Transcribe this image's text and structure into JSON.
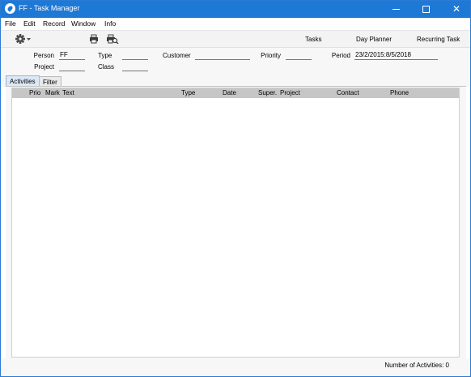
{
  "window": {
    "title": "FF - Task Manager"
  },
  "menu": [
    "File",
    "Edit",
    "Record",
    "Window",
    "Info"
  ],
  "toolbar": {
    "icons": [
      "gear-icon",
      "print-icon",
      "print-preview-icon"
    ],
    "links": [
      "Tasks",
      "Day Planner",
      "Recurring Task"
    ]
  },
  "fields": {
    "person": {
      "label": "Person",
      "value": "FF"
    },
    "type": {
      "label": "Type",
      "value": ""
    },
    "customer": {
      "label": "Customer",
      "value": ""
    },
    "priority": {
      "label": "Priority",
      "value": ""
    },
    "period": {
      "label": "Period",
      "value": "23/2/2015:8/5/2018"
    },
    "project": {
      "label": "Project",
      "value": ""
    },
    "class": {
      "label": "Class",
      "value": ""
    }
  },
  "tabs": [
    "Activities",
    "Filter"
  ],
  "columns": [
    "Prio",
    "Mark",
    "Text",
    "Type",
    "Date",
    "Super.",
    "Project",
    "Contact",
    "Phone"
  ],
  "rows": [],
  "status": "Number of Activities: 0",
  "colors": {
    "titlebar": "#1e78d6",
    "header": "#c6c6c6",
    "active_tab": "#dce8f6"
  }
}
